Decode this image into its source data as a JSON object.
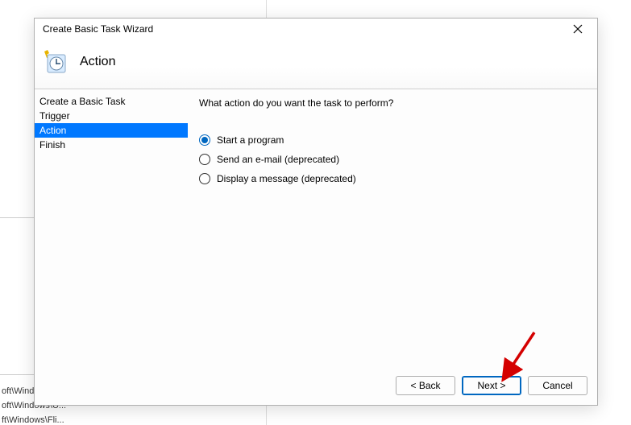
{
  "background": {
    "path1": "oft\\Wind",
    "path2": "oft\\Windows\\U...",
    "path3": "ft\\Windows\\Fli..."
  },
  "dialog": {
    "title": "Create Basic Task Wizard",
    "step_heading": "Action",
    "sidebar": {
      "items": [
        {
          "label": "Create a Basic Task",
          "selected": false
        },
        {
          "label": "Trigger",
          "selected": false
        },
        {
          "label": "Action",
          "selected": true
        },
        {
          "label": "Finish",
          "selected": false
        }
      ]
    },
    "content": {
      "prompt": "What action do you want the task to perform?",
      "options": [
        {
          "label": "Start a program",
          "checked": true
        },
        {
          "label": "Send an e-mail (deprecated)",
          "checked": false
        },
        {
          "label": "Display a message (deprecated)",
          "checked": false
        }
      ]
    },
    "footer": {
      "back": "< Back",
      "next": "Next >",
      "cancel": "Cancel"
    }
  }
}
